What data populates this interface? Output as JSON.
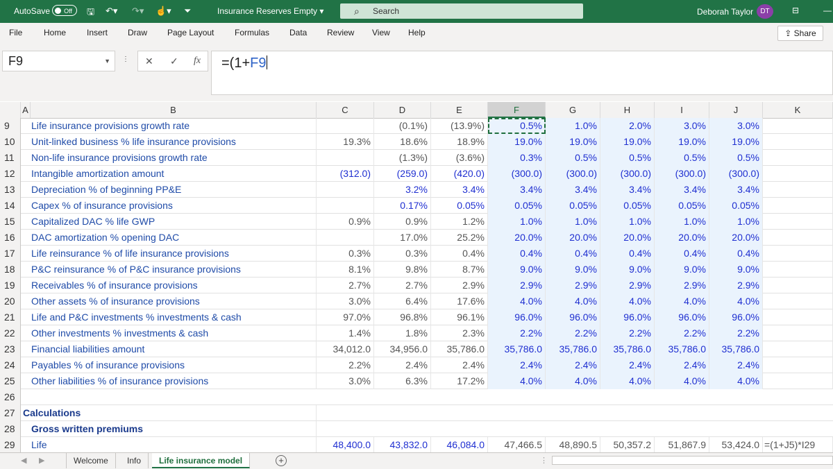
{
  "titlebar": {
    "autosave_label": "AutoSave",
    "autosave_state": "Off",
    "document": "Insurance Reserves Empty",
    "search_placeholder": "Search",
    "user_name": "Deborah Taylor",
    "user_initials": "DT",
    "color": "#217346"
  },
  "menu": [
    "File",
    "Home",
    "Insert",
    "Draw",
    "Page Layout",
    "Formulas",
    "Data",
    "Review",
    "View",
    "Help"
  ],
  "share_label": "Share",
  "formula_bar": {
    "name_box": "F9",
    "formula_prefix": "=(1+",
    "formula_ref": "F9"
  },
  "columns": [
    "A",
    "B",
    "C",
    "D",
    "E",
    "F",
    "G",
    "H",
    "I",
    "J",
    "K"
  ],
  "rows": [
    {
      "num": "9",
      "label": "Life insurance provisions growth rate",
      "c": "",
      "d": "(0.1%)",
      "e": "(13.9%)",
      "f": [
        "0.5%",
        "1.0%",
        "2.0%",
        "3.0%",
        "3.0%"
      ]
    },
    {
      "num": "10",
      "label": "Unit-linked business % life insurance provisions",
      "c": "19.3%",
      "d": "18.6%",
      "e": "18.9%",
      "f": [
        "19.0%",
        "19.0%",
        "19.0%",
        "19.0%",
        "19.0%"
      ]
    },
    {
      "num": "11",
      "label": "Non-life insurance provisions growth rate",
      "c": "",
      "d": "(1.3%)",
      "e": "(3.6%)",
      "f": [
        "0.3%",
        "0.5%",
        "0.5%",
        "0.5%",
        "0.5%"
      ]
    },
    {
      "num": "12",
      "label": "Intangible amortization amount",
      "c": "(312.0)",
      "d": "(259.0)",
      "e": "(420.0)",
      "f": [
        "(300.0)",
        "(300.0)",
        "(300.0)",
        "(300.0)",
        "(300.0)"
      ],
      "hist_blue": true
    },
    {
      "num": "13",
      "label": "Depreciation % of beginning PP&E",
      "c": "",
      "d": "3.2%",
      "e": "3.4%",
      "f": [
        "3.4%",
        "3.4%",
        "3.4%",
        "3.4%",
        "3.4%"
      ],
      "hist_blue": true
    },
    {
      "num": "14",
      "label": "Capex % of insurance provisions",
      "c": "",
      "d": "0.17%",
      "e": "0.05%",
      "f": [
        "0.05%",
        "0.05%",
        "0.05%",
        "0.05%",
        "0.05%"
      ],
      "hist_blue": true
    },
    {
      "num": "15",
      "label": "Capitalized DAC % life GWP",
      "c": "0.9%",
      "d": "0.9%",
      "e": "1.2%",
      "f": [
        "1.0%",
        "1.0%",
        "1.0%",
        "1.0%",
        "1.0%"
      ]
    },
    {
      "num": "16",
      "label": "DAC amortization % opening DAC",
      "c": "",
      "d": "17.0%",
      "e": "25.2%",
      "f": [
        "20.0%",
        "20.0%",
        "20.0%",
        "20.0%",
        "20.0%"
      ]
    },
    {
      "num": "17",
      "label": "Life reinsurance % of life insurance provisions",
      "c": "0.3%",
      "d": "0.3%",
      "e": "0.4%",
      "f": [
        "0.4%",
        "0.4%",
        "0.4%",
        "0.4%",
        "0.4%"
      ]
    },
    {
      "num": "18",
      "label": "P&C reinsurance % of P&C insurance provisions",
      "c": "8.1%",
      "d": "9.8%",
      "e": "8.7%",
      "f": [
        "9.0%",
        "9.0%",
        "9.0%",
        "9.0%",
        "9.0%"
      ]
    },
    {
      "num": "19",
      "label": "Receivables % of insurance provisions",
      "c": "2.7%",
      "d": "2.7%",
      "e": "2.9%",
      "f": [
        "2.9%",
        "2.9%",
        "2.9%",
        "2.9%",
        "2.9%"
      ]
    },
    {
      "num": "20",
      "label": "Other assets % of insurance provisions",
      "c": "3.0%",
      "d": "6.4%",
      "e": "17.6%",
      "f": [
        "4.0%",
        "4.0%",
        "4.0%",
        "4.0%",
        "4.0%"
      ]
    },
    {
      "num": "21",
      "label": "Life and P&C investments % investments & cash",
      "c": "97.0%",
      "d": "96.8%",
      "e": "96.1%",
      "f": [
        "96.0%",
        "96.0%",
        "96.0%",
        "96.0%",
        "96.0%"
      ]
    },
    {
      "num": "22",
      "label": "Other investments % investments & cash",
      "c": "1.4%",
      "d": "1.8%",
      "e": "2.3%",
      "f": [
        "2.2%",
        "2.2%",
        "2.2%",
        "2.2%",
        "2.2%"
      ]
    },
    {
      "num": "23",
      "label": "Financial liabilities amount",
      "c": "34,012.0",
      "d": "34,956.0",
      "e": "35,786.0",
      "f": [
        "35,786.0",
        "35,786.0",
        "35,786.0",
        "35,786.0",
        "35,786.0"
      ]
    },
    {
      "num": "24",
      "label": "Payables % of insurance provisions",
      "c": "2.2%",
      "d": "2.4%",
      "e": "2.4%",
      "f": [
        "2.4%",
        "2.4%",
        "2.4%",
        "2.4%",
        "2.4%"
      ]
    },
    {
      "num": "25",
      "label": "Other liabilities % of insurance provisions",
      "c": "3.0%",
      "d": "6.3%",
      "e": "17.2%",
      "f": [
        "4.0%",
        "4.0%",
        "4.0%",
        "4.0%",
        "4.0%"
      ]
    }
  ],
  "row26": "26",
  "row27": {
    "num": "27",
    "label": "Calculations"
  },
  "row28": {
    "num": "28",
    "label": "Gross written premiums"
  },
  "row29": {
    "num": "29",
    "label": "Life",
    "c": "48,400.0",
    "d": "43,832.0",
    "e": "46,084.0",
    "f": [
      "47,466.5",
      "48,890.5",
      "50,357.2",
      "51,867.9",
      "53,424.0"
    ],
    "k": "=(1+J5)*I29"
  },
  "sheets": [
    "Welcome",
    "Info",
    "Life insurance model"
  ]
}
